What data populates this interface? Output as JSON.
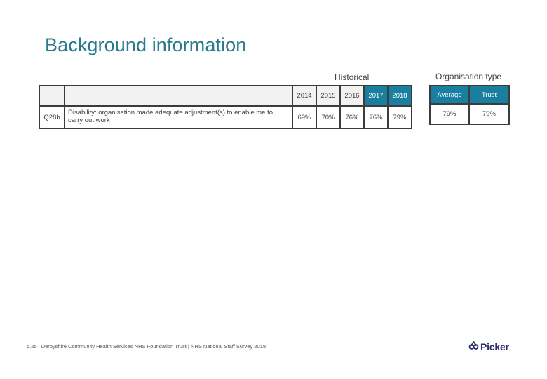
{
  "page": {
    "title": "Background information"
  },
  "groups": {
    "historical": "Historical",
    "organisation_type": "Organisation type"
  },
  "table": {
    "years": [
      "2014",
      "2015",
      "2016",
      "2017",
      "2018"
    ],
    "org_headers": [
      "Average",
      "Trust"
    ],
    "row": {
      "code": "Q28b",
      "description": "Disability: organisation made adequate adjustment(s) to enable me to carry out work",
      "historical_values": [
        "69%",
        "70%",
        "76%",
        "76%",
        "79%"
      ],
      "org_values": [
        "79%",
        "79%"
      ]
    }
  },
  "colors": {
    "title": "#2a7a8e",
    "header_highlight": "#1a7f9e",
    "border": "#3c3c3c",
    "logo": "#2d2e6b"
  },
  "footer": {
    "text": "p.25 | Derbyshire Community Health Services NHS Foundation Trust | NHS National Staff Survey 2018"
  },
  "logo": {
    "icon": "picker-logo-icon",
    "text": "Picker"
  }
}
